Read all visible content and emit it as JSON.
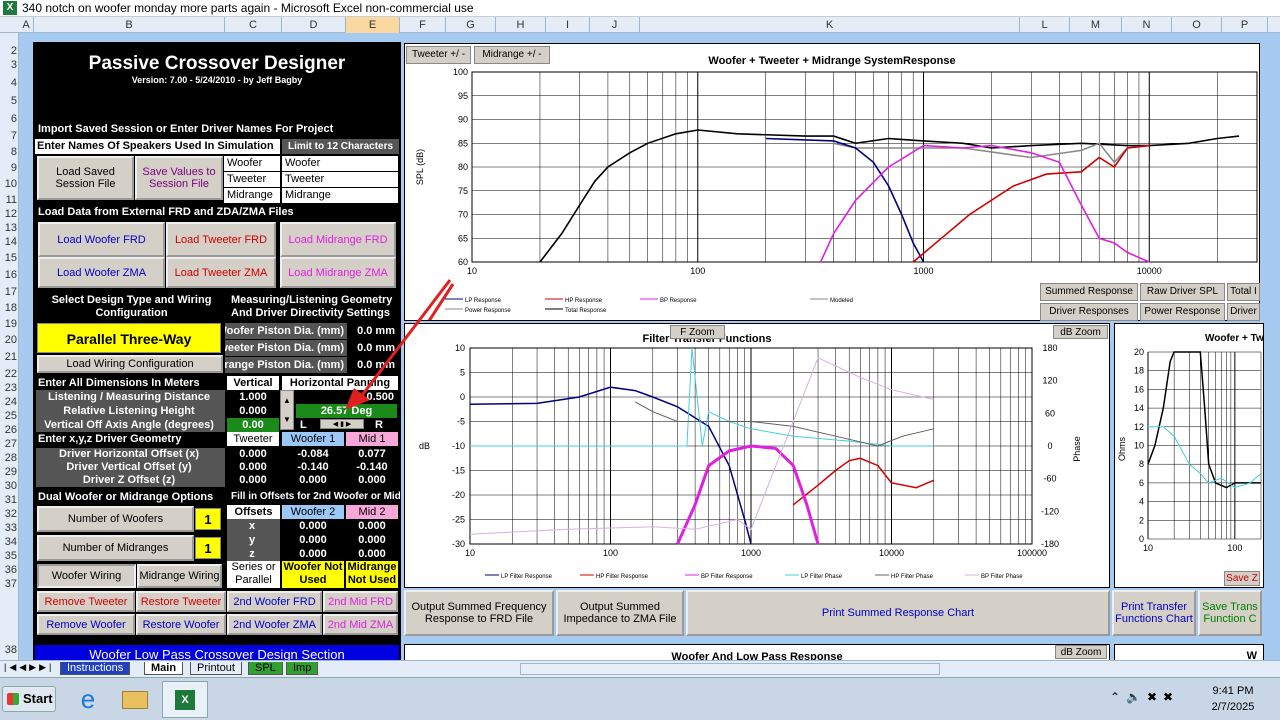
{
  "window": {
    "title": "340 notch on woofer monday more parts again - Microsoft Excel non-commercial use",
    "icon": "excel-icon"
  },
  "columns": [
    "A",
    "B",
    "C",
    "D",
    "E",
    "F",
    "G",
    "H",
    "I",
    "J",
    "K",
    "L",
    "M",
    "N",
    "O",
    "P"
  ],
  "rows": [
    "2",
    "3",
    "4",
    "5",
    "6",
    "7",
    "8",
    "9",
    "10",
    "11",
    "12",
    "13",
    "14",
    "15",
    "16",
    "17",
    "18",
    "19",
    "20",
    "21",
    "22",
    "23",
    "24",
    "25",
    "26",
    "27",
    "28",
    "29",
    "30",
    "31",
    "32",
    "33",
    "34",
    "35",
    "36",
    "37",
    "38"
  ],
  "app": {
    "title": "Passive Crossover Designer",
    "version": "Version: 7.00  -  5/24/2010  -  by Jeff Bagby"
  },
  "import": {
    "header": "Import Saved Session or Enter Driver Names For Project",
    "names_header": "Enter Names Of Speakers Used In Simulation",
    "limit": "Limit to 12 Characters",
    "load_session": "Load Saved Session File",
    "save_values": "Save Values to Session File",
    "drivers": [
      {
        "label": "Woofer",
        "name": "Woofer"
      },
      {
        "label": "Tweeter",
        "name": "Tweeter"
      },
      {
        "label": "Midrange",
        "name": "Midrange"
      }
    ]
  },
  "load_data": {
    "header": "Load Data from External FRD and ZDA/ZMA Files",
    "woofer_frd": "Load Woofer FRD",
    "tweeter_frd": "Load Tweeter FRD",
    "mid_frd": "Load Midrange FRD",
    "woofer_zma": "Load Woofer ZMA",
    "tweeter_zma": "Load Tweeter ZMA",
    "mid_zma": "Load Midrange ZMA"
  },
  "design": {
    "header": "Select Design Type and Wiring Configuration",
    "type": "Parallel Three-Way",
    "load_wiring": "Load Wiring Configuration"
  },
  "geometry": {
    "header": "Measuring/Listening Geometry And Driver Directivity Settings",
    "rows": [
      {
        "label": "Woofer Piston Dia. (mm)",
        "value": "0.0 mm"
      },
      {
        "label": "Tweeter Piston Dia. (mm)",
        "value": "0.0 mm"
      },
      {
        "label": "Midrange Piston Dia. (mm)",
        "value": "0.0 mm"
      }
    ]
  },
  "dims": {
    "header": "Enter All Dimensions In Meters",
    "vertical": "Vertical",
    "horizontal": "Horizontal Panning",
    "rows": [
      {
        "label": "Listening / Measuring  Distance",
        "value": "1.000"
      },
      {
        "label": "Relative Listening Height",
        "value": "0.000"
      },
      {
        "label": "Vertical Off Axis Angle (degrees)",
        "value": "0.00"
      }
    ],
    "h_distance": "0.500",
    "h_angle": "26.57 Deg",
    "left": "L",
    "right": "R"
  },
  "xyz": {
    "header": "Enter x,y,z Driver Geometry",
    "cols": [
      "Tweeter",
      "Woofer 1",
      "Mid 1"
    ],
    "rows": [
      {
        "label": "Driver Horizontal Offset (x)",
        "values": [
          "0.000",
          "-0.084",
          "0.077"
        ]
      },
      {
        "label": "Driver Vertical Offset (y)",
        "values": [
          "0.000",
          "-0.140",
          "-0.140"
        ]
      },
      {
        "label": "Driver Z Offset (z)",
        "values": [
          "0.000",
          "0.000",
          "0.000"
        ]
      }
    ]
  },
  "dual": {
    "header": "Dual Woofer or Midrange Options",
    "fill_header": "Fill in Offsets for 2nd Woofer or Mid",
    "num_woofers_label": "Number of Woofers",
    "num_woofers": "1",
    "num_mids_label": "Number of Midranges",
    "num_mids": "1",
    "offsets": "Offsets",
    "cols": [
      "Woofer 2",
      "Mid 2"
    ],
    "rows": [
      {
        "label": "x",
        "values": [
          "0.000",
          "0.000"
        ]
      },
      {
        "label": "y",
        "values": [
          "0.000",
          "0.000"
        ]
      },
      {
        "label": "z",
        "values": [
          "0.000",
          "0.000"
        ]
      }
    ],
    "woofer_wiring": "Woofer Wiring",
    "mid_wiring": "Midrange Wiring",
    "series_parallel": "Series or Parallel",
    "woofer_nu": "Woofer Not Used",
    "mid_nu": "Midrange Not Used"
  },
  "actions": {
    "remove_tweeter": "Remove Tweeter",
    "restore_tweeter": "Restore Tweeter",
    "woofer2_frd": "2nd Woofer FRD",
    "mid2_frd": "2nd Mid FRD",
    "remove_woofer": "Remove Woofer",
    "restore_woofer": "Restore Woofer",
    "woofer2_zma": "2nd Woofer ZMA",
    "mid2_zma": "2nd Mid ZMA"
  },
  "lowpass_header": "Woofer Low Pass Crossover Design Section",
  "chart1": {
    "title": "Woofer + Tweeter + Midrange SystemResponse",
    "ylabel": "SPL (dB)",
    "btn_tweeter": "Tweeter +/ -",
    "btn_mid": "Midrange  +/ -",
    "yticks": [
      "100",
      "95",
      "90",
      "85",
      "80",
      "75",
      "70",
      "65",
      "60"
    ],
    "xticks": [
      "10",
      "100",
      "1000",
      "10000"
    ],
    "legend": [
      "LP Response",
      "HP Response",
      "BP Response",
      "Modeled",
      "Power Response",
      "Total Response"
    ]
  },
  "chart_tabs": {
    "summed": "Summed Response",
    "raw": "Raw Driver SPL",
    "total": "Total I",
    "driver_resp": "Driver Responses",
    "power": "Power Response",
    "driver2": "Driver"
  },
  "chart2": {
    "title": "Filter Transfer Functions",
    "fzoom": "F Zoom",
    "dbzoom": "dB Zoom",
    "ylabel": "dB",
    "y2label": "Phase",
    "yticks": [
      "10",
      "5",
      "0",
      "-5",
      "-10",
      "-15",
      "-20",
      "-25",
      "-30"
    ],
    "y2ticks": [
      "180",
      "120",
      "60",
      "0",
      "-60",
      "-120",
      "-180"
    ],
    "xticks": [
      "10",
      "100",
      "1000",
      "10000",
      "100000"
    ],
    "legend": [
      "LP Filter Response",
      "HP Filter Response",
      "BP Filter Response",
      "LP Filter Phase",
      "HP Filter Phase",
      "BP Filter Phase"
    ]
  },
  "chart3": {
    "title": "Woofer + Tw",
    "ylabel": "Ohms",
    "yticks": [
      "20",
      "18",
      "16",
      "14",
      "12",
      "10",
      "8",
      "6",
      "4",
      "2",
      "0"
    ],
    "xticks": [
      "10",
      "100"
    ],
    "savez": "Save Z t"
  },
  "bottom_buttons": {
    "out_frd": "Output Summed Frequency Response to FRD File",
    "out_zma": "Output Summed Impedance to ZMA File",
    "print_summed": "Print Summed Response Chart",
    "print_transfer": "Print Transfer Functions Chart",
    "save_transfer": "Save Trans Function C"
  },
  "chart4": {
    "title": "Woofer  And Low Pass Response",
    "dbzoom": "dB Zoom",
    "partial": "W"
  },
  "sheet_tabs": [
    "Instructions",
    "Main",
    "Printout",
    "SPL",
    "Imp"
  ],
  "taskbar": {
    "start": "Start",
    "time": "9:41 PM",
    "date": "2/7/2025"
  },
  "colors": {
    "lp": "#000080",
    "hp": "#d00000",
    "bp": "#e020e0",
    "total": "#000000",
    "power": "#888888",
    "lp_phase": "#40d0e0",
    "hp_phase": "#606060",
    "bp_phase": "#d8b0e0"
  }
}
